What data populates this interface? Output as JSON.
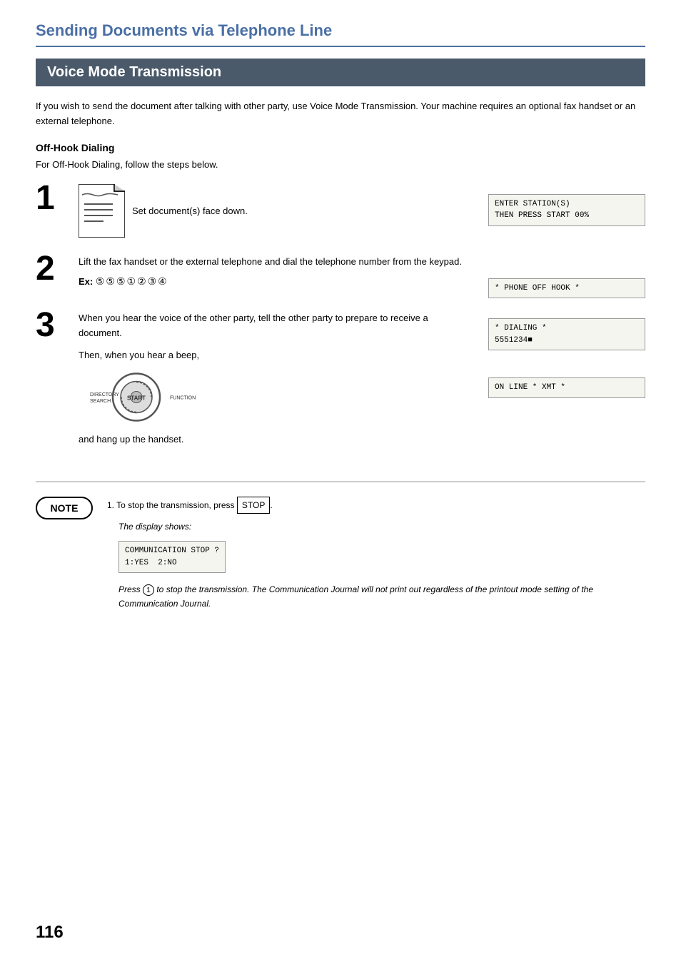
{
  "page": {
    "title": "Sending Documents via Telephone Line",
    "section_title": "Voice Mode Transmission",
    "intro": "If you wish to send the document after talking with other party, use Voice Mode Transmission.  Your machine requires an optional fax handset or an external telephone.",
    "subsection_title": "Off-Hook Dialing",
    "subsection_intro": "For Off-Hook Dialing, follow the steps below.",
    "page_number": "116"
  },
  "steps": [
    {
      "number": "1",
      "text": "Set document(s) face down.",
      "display": "ENTER STATION(S)\nTHEN PRESS START 00%"
    },
    {
      "number": "2",
      "text": "Lift the fax handset or the external telephone and dial the telephone number from the keypad.",
      "example_label": "Ex:",
      "example_value": "⑤⑤⑤①②③④",
      "display1": "* PHONE OFF HOOK *",
      "display2": "* DIALING *\n5551234■"
    },
    {
      "number": "3",
      "text": "When you hear the voice of the other party, tell the other party to prepare to receive a document.",
      "display": "ON LINE * XMT *",
      "beep_text": "Then, when you hear a beep,",
      "start_label": "START",
      "start_left": "DIRECTORY\nSEARCH",
      "start_right": "FUNCTION",
      "hang_up_text": "and hang up the handset."
    }
  ],
  "note": {
    "badge": "NOTE",
    "item1_prefix": "1.  To stop the transmission, press ",
    "stop_button": "STOP",
    "item1_suffix": ".",
    "display_text": "The display shows:",
    "communication_display": "COMMUNICATION STOP ?\n1:YES  2:NO",
    "italic_text": "Press",
    "circle_num": "1",
    "italic_rest": " to stop the transmission. The Communication Journal will not print out regardless of the printout mode setting of the Communication Journal."
  }
}
